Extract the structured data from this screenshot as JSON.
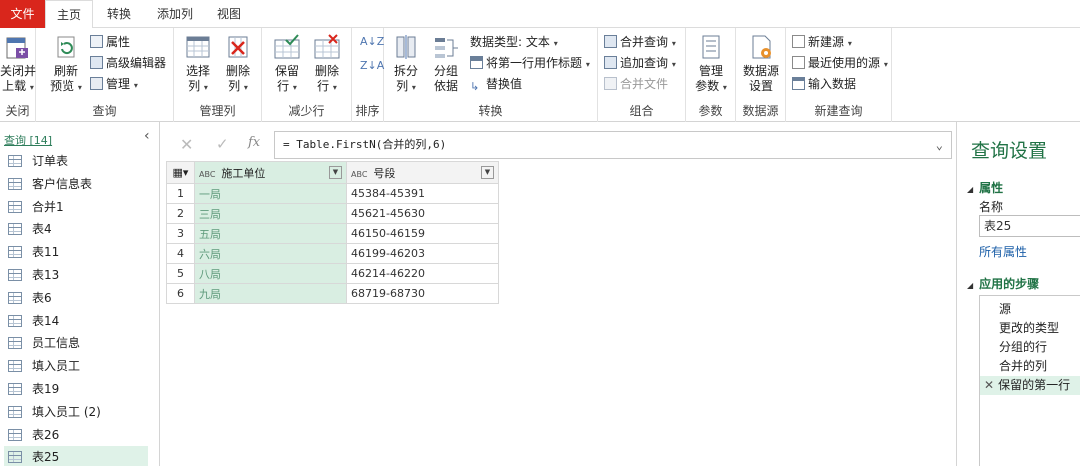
{
  "menu": {
    "file": "文件",
    "home": "主页",
    "transform": "转换",
    "add_column": "添加列",
    "view": "视图"
  },
  "ribbon": {
    "close": {
      "btn_close_load": "关闭并\n上载",
      "label": "关闭"
    },
    "query": {
      "refresh_preview": "刷新\n预览",
      "properties": "属性",
      "advanced_editor": "高级编辑器",
      "manage": "管理",
      "label": "查询"
    },
    "manage_columns": {
      "choose_columns": "选择\n列",
      "remove_columns": "删除\n列",
      "label": "管理列"
    },
    "reduce_rows": {
      "keep_rows": "保留\n行",
      "remove_rows": "删除\n行",
      "label": "减少行"
    },
    "sort": {
      "label": "排序"
    },
    "transform": {
      "split_column": "拆分\n列",
      "group_by": "分组\n依据",
      "data_type": "数据类型: 文本",
      "use_first_row": "将第一行用作标题",
      "replace_values": "替换值",
      "label": "转换"
    },
    "combine": {
      "merge_queries": "合并查询",
      "append_queries": "追加查询",
      "combine_files": "合并文件",
      "label": "组合"
    },
    "parameters": {
      "manage_parameters": "管理\n参数",
      "label": "参数"
    },
    "data_sources": {
      "data_source_settings": "数据源\n设置",
      "label": "数据源"
    },
    "new_query": {
      "new_source": "新建源",
      "recent_sources": "最近使用的源",
      "enter_data": "输入数据",
      "label": "新建查询"
    }
  },
  "queries": {
    "header": "查询 [14]",
    "items": [
      "订单表",
      "客户信息表",
      "合并1",
      "表4",
      "表11",
      "表13",
      "表6",
      "表14",
      "员工信息",
      "填入员工",
      "表19",
      "填入员工 (2)",
      "表26",
      "表25"
    ],
    "selected": "表25"
  },
  "formula": {
    "text": "= Table.FirstN(合并的列,6)",
    "fx": "fx"
  },
  "table": {
    "columns": [
      "施工单位",
      "号段"
    ],
    "type_badge": "ABC",
    "rows": [
      {
        "n": "1",
        "unit": "一局",
        "range": "45384-45391"
      },
      {
        "n": "2",
        "unit": "三局",
        "range": "45621-45630"
      },
      {
        "n": "3",
        "unit": "五局",
        "range": "46150-46159"
      },
      {
        "n": "4",
        "unit": "六局",
        "range": "46199-46203"
      },
      {
        "n": "5",
        "unit": "八局",
        "range": "46214-46220"
      },
      {
        "n": "6",
        "unit": "九局",
        "range": "68719-68730"
      }
    ]
  },
  "settings": {
    "title": "查询设置",
    "properties_header": "属性",
    "name_label": "名称",
    "name_value": "表25",
    "all_properties": "所有属性",
    "steps_header": "应用的步骤",
    "steps": [
      "源",
      "更改的类型",
      "分组的行",
      "合并的列",
      "保留的第一行"
    ],
    "selected_step": "保留的第一行"
  },
  "colors": {
    "accent": "#217346",
    "file_tab": "#d9261c",
    "selection": "#dff2e8"
  }
}
